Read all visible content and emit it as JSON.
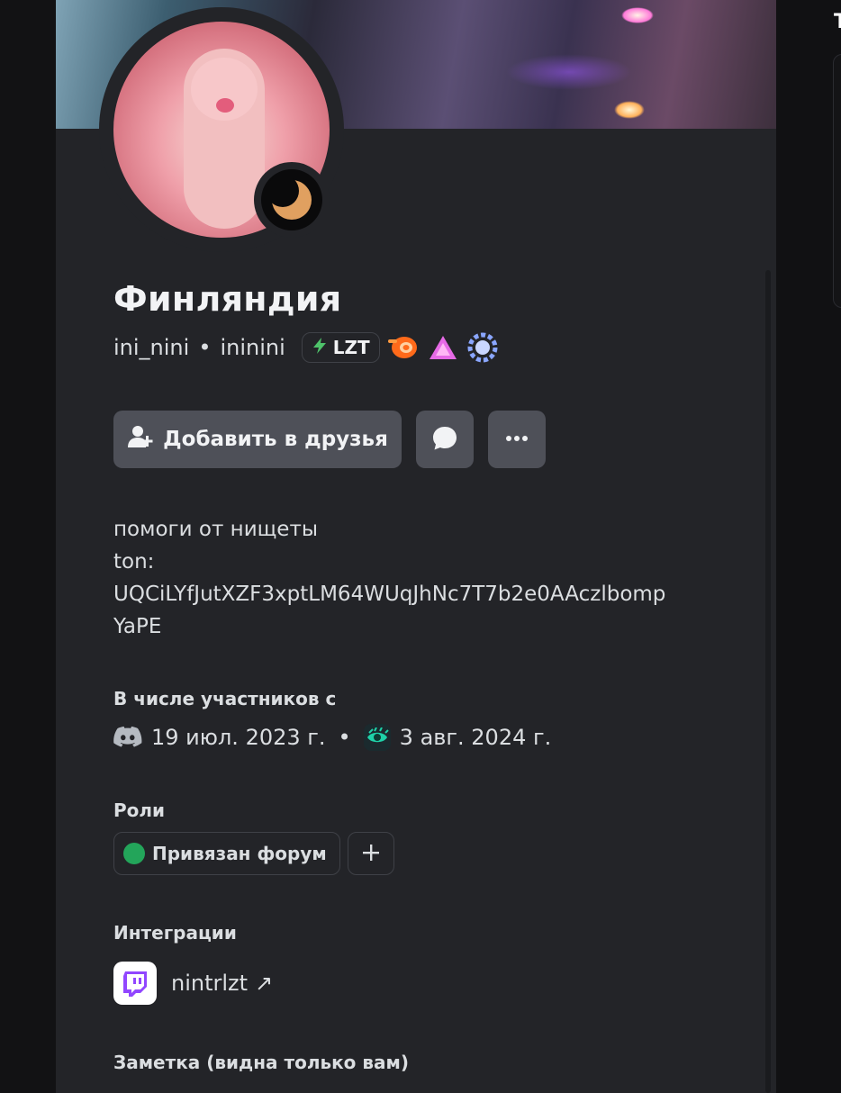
{
  "profile": {
    "display_name": "Финляндия",
    "username": "ini_nini",
    "pronoun_sep": "•",
    "alt_name": "ininini",
    "clan_tag": "LZT",
    "badges": [
      "orange-swirl-badge-icon",
      "pink-triangle-badge-icon",
      "blue-laurel-badge-icon"
    ],
    "status": "idle"
  },
  "actions": {
    "add_friend_label": "Добавить в друзья",
    "message_icon": "chat-bubble-icon",
    "more_icon": "ellipsis-icon"
  },
  "bio": {
    "line1": "помоги от нищеты",
    "line2": "ton:",
    "line3": "UQCiLYfJutXZF3xptLM64WUqJhNc7T7b2e0AAczlbomp",
    "line4": "YaPE"
  },
  "member_since": {
    "title": "В числе участников с",
    "discord_date": "19 июл. 2023 г.",
    "separator": "•",
    "server_date": "3 авг. 2024 г."
  },
  "roles": {
    "title": "Роли",
    "items": [
      {
        "label": "Привязан форум",
        "color": "#23a55a"
      }
    ],
    "add_label": "+"
  },
  "integrations": {
    "title": "Интеграции",
    "twitch_name": "nintrlzt",
    "arrow": "↗"
  },
  "note": {
    "title": "Заметка (видна только вам)"
  },
  "side": {
    "letter": "T"
  },
  "colors": {
    "background": "#121214",
    "card": "#232428",
    "button": "#4e5058",
    "role_dot": "#23a55a",
    "twitch": "#9146ff"
  }
}
